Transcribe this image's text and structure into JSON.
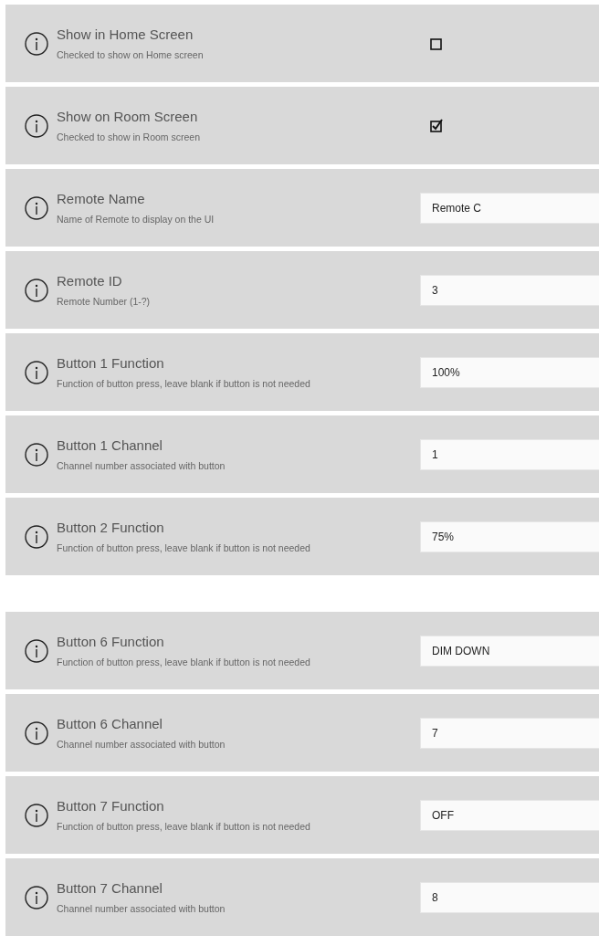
{
  "sections": [
    {
      "rows": [
        {
          "kind": "checkbox",
          "title": "Show in Home Screen",
          "description": "Checked to show on Home screen",
          "checked": false
        },
        {
          "kind": "checkbox",
          "title": "Show on Room Screen",
          "description": "Checked to show in Room screen",
          "checked": true
        },
        {
          "kind": "text",
          "title": "Remote Name",
          "description": "Name of Remote to display on the UI",
          "value": "Remote C"
        },
        {
          "kind": "text",
          "title": "Remote ID",
          "description": "Remote Number (1-?)",
          "value": "3"
        },
        {
          "kind": "text",
          "title": "Button 1 Function",
          "description": "Function of button press, leave blank if button is not needed",
          "value": "100%"
        },
        {
          "kind": "text",
          "title": "Button 1 Channel",
          "description": "Channel number associated with button",
          "value": "1"
        },
        {
          "kind": "text",
          "title": "Button 2 Function",
          "description": "Function of button press, leave blank if button is not needed",
          "value": "75%"
        }
      ]
    },
    {
      "rows": [
        {
          "kind": "text",
          "title": "Button 6 Function",
          "description": "Function of button press, leave blank if button is not needed",
          "value": "DIM DOWN"
        },
        {
          "kind": "text",
          "title": "Button 6 Channel",
          "description": "Channel number associated with button",
          "value": "7"
        },
        {
          "kind": "text",
          "title": "Button 7 Function",
          "description": "Function of button press, leave blank if button is not needed",
          "value": "OFF"
        },
        {
          "kind": "text",
          "title": "Button 7 Channel",
          "description": "Channel number associated with button",
          "value": "8"
        }
      ]
    }
  ]
}
